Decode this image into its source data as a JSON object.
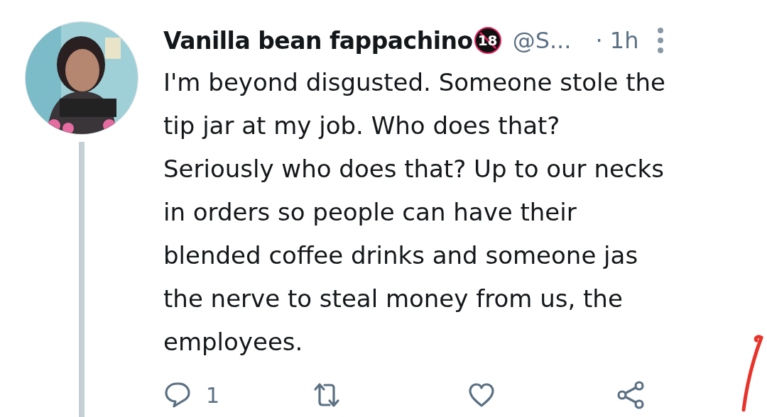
{
  "tweet": {
    "author_name": "Vanilla bean fappachino",
    "badge": "18",
    "handle": "@S...",
    "time": "· 1h",
    "body_lines": [
      "I'm beyond disgusted. Someone stole the",
      "tip jar at my job. Who does that?",
      "Seriously who does that? Up to our necks",
      "in orders so people can have their",
      "blended coffee drinks and someone jas",
      "the nerve to steal money from us, the",
      "employees."
    ],
    "actions": [
      {
        "kind": "reply",
        "count": "1"
      },
      {
        "kind": "retweet"
      },
      {
        "kind": "like"
      },
      {
        "kind": "share"
      }
    ]
  }
}
